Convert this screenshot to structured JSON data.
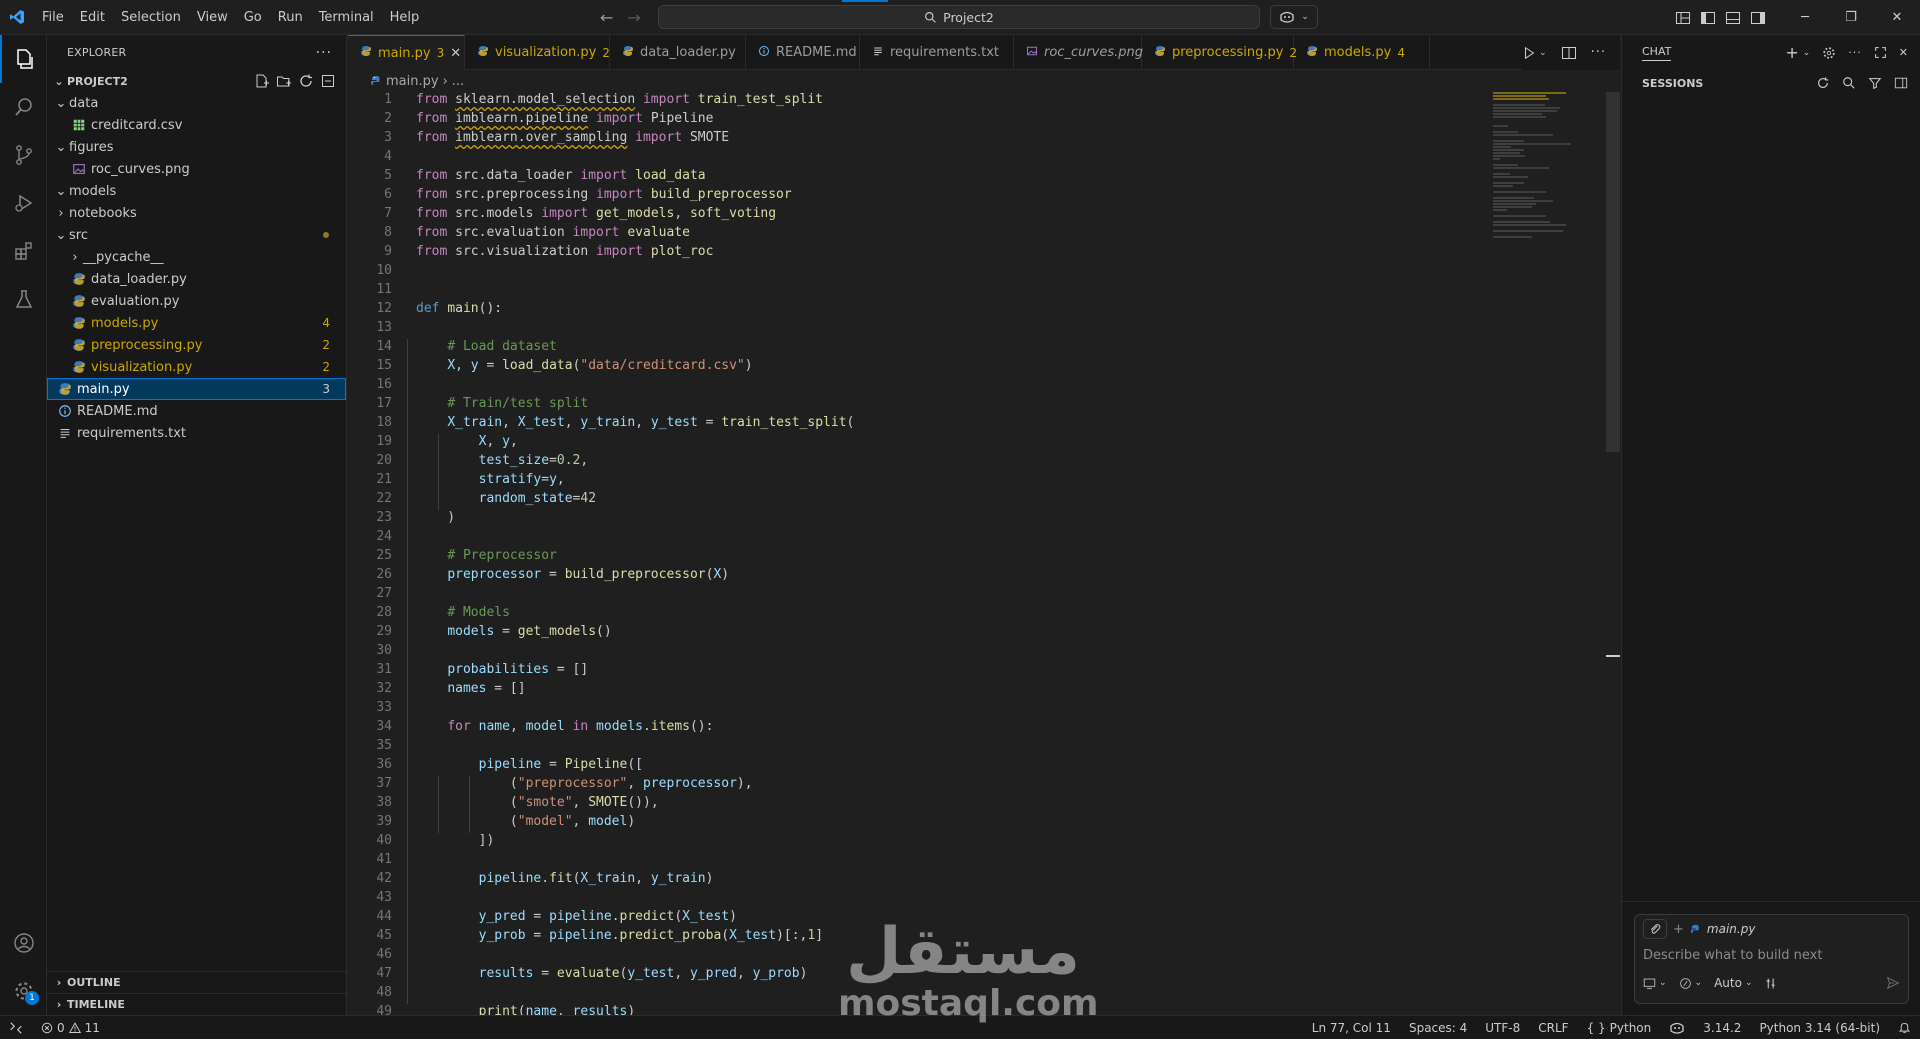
{
  "titlebar": {
    "menu": [
      "File",
      "Edit",
      "Selection",
      "View",
      "Go",
      "Run",
      "Terminal",
      "Help"
    ],
    "search_text": "Project2"
  },
  "sidebar": {
    "title": "EXPLORER",
    "project": "PROJECT2",
    "tree": [
      {
        "label": "data",
        "type": "folder",
        "open": true,
        "depth": 0
      },
      {
        "label": "creditcard.csv",
        "type": "csv",
        "depth": 1
      },
      {
        "label": "figures",
        "type": "folder",
        "open": true,
        "depth": 0
      },
      {
        "label": "roc_curves.png",
        "type": "image",
        "depth": 1
      },
      {
        "label": "models",
        "type": "folder",
        "open": true,
        "depth": 0
      },
      {
        "label": "notebooks",
        "type": "folder",
        "open": false,
        "depth": 0
      },
      {
        "label": "src",
        "type": "folder",
        "open": true,
        "depth": 0,
        "warn": true
      },
      {
        "label": "__pycache__",
        "type": "folder",
        "open": false,
        "depth": 1
      },
      {
        "label": "data_loader.py",
        "type": "py",
        "depth": 1
      },
      {
        "label": "evaluation.py",
        "type": "py",
        "depth": 1
      },
      {
        "label": "models.py",
        "type": "py",
        "depth": 1,
        "warn": true,
        "count": "4"
      },
      {
        "label": "preprocessing.py",
        "type": "py",
        "depth": 1,
        "warn": true,
        "count": "2"
      },
      {
        "label": "visualization.py",
        "type": "py",
        "depth": 1,
        "warn": true,
        "count": "2"
      },
      {
        "label": "main.py",
        "type": "py",
        "depth": 0,
        "warn": true,
        "count": "3",
        "selected": true
      },
      {
        "label": "README.md",
        "type": "info",
        "depth": 0
      },
      {
        "label": "requirements.txt",
        "type": "txt",
        "depth": 0
      }
    ],
    "outline": "OUTLINE",
    "timeline": "TIMELINE"
  },
  "tabs": [
    {
      "label": "main.py",
      "count": "3",
      "active": true,
      "icon": "python-icon",
      "warn": true
    },
    {
      "label": "visualization.py",
      "count": "2",
      "icon": "python-icon",
      "warn": true
    },
    {
      "label": "data_loader.py",
      "count": "",
      "icon": "python-icon"
    },
    {
      "label": "README.md",
      "count": "",
      "icon": "info-icon"
    },
    {
      "label": "requirements.txt",
      "count": "",
      "icon": "lines-icon"
    },
    {
      "label": "roc_curves.png",
      "count": "",
      "icon": "image-icon",
      "italic": true
    },
    {
      "label": "preprocessing.py",
      "count": "2",
      "icon": "python-icon",
      "warn": true
    },
    {
      "label": "models.py",
      "count": "4",
      "icon": "python-icon",
      "warn": true
    }
  ],
  "breadcrumb": {
    "file": "main.py",
    "rest": "..."
  },
  "code_lines": [
    [
      [
        "kw-imp",
        "from "
      ],
      [
        "mod ul",
        "sklearn.model_selection"
      ],
      [
        "kw-imp",
        " import "
      ],
      [
        "fn",
        "train_test_split"
      ]
    ],
    [
      [
        "kw-imp",
        "from "
      ],
      [
        "mod ul",
        "imblearn.pipeline"
      ],
      [
        "kw-imp",
        " import "
      ],
      [
        "mod",
        "Pipeline"
      ]
    ],
    [
      [
        "kw-imp",
        "from "
      ],
      [
        "mod ul",
        "imblearn.over_sampling"
      ],
      [
        "kw-imp",
        " import "
      ],
      [
        "mod",
        "SMOTE"
      ]
    ],
    [],
    [
      [
        "kw-imp",
        "from "
      ],
      [
        "mod",
        "src.data_loader"
      ],
      [
        "kw-imp",
        " import "
      ],
      [
        "fn",
        "load_data"
      ]
    ],
    [
      [
        "kw-imp",
        "from "
      ],
      [
        "mod",
        "src.preprocessing"
      ],
      [
        "kw-imp",
        " import "
      ],
      [
        "fn",
        "build_preprocessor"
      ]
    ],
    [
      [
        "kw-imp",
        "from "
      ],
      [
        "mod",
        "src.models"
      ],
      [
        "kw-imp",
        " import "
      ],
      [
        "fn",
        "get_models"
      ],
      [
        "mod",
        ", "
      ],
      [
        "fn",
        "soft_voting"
      ]
    ],
    [
      [
        "kw-imp",
        "from "
      ],
      [
        "mod",
        "src.evaluation"
      ],
      [
        "kw-imp",
        " import "
      ],
      [
        "fn",
        "evaluate"
      ]
    ],
    [
      [
        "kw-imp",
        "from "
      ],
      [
        "mod",
        "src.visualization"
      ],
      [
        "kw-imp",
        " import "
      ],
      [
        "fn",
        "plot_roc"
      ]
    ],
    [],
    [],
    [
      [
        "kw-def",
        "def "
      ],
      [
        "fn",
        "main"
      ],
      [
        "mod",
        "():"
      ]
    ],
    [],
    [
      [
        "mod",
        "    "
      ],
      [
        "cm",
        "# Load dataset"
      ]
    ],
    [
      [
        "mod",
        "    "
      ],
      [
        "var",
        "X"
      ],
      [
        "mod",
        ", "
      ],
      [
        "var",
        "y"
      ],
      [
        "mod",
        " = "
      ],
      [
        "fn",
        "load_data"
      ],
      [
        "mod",
        "("
      ],
      [
        "str",
        "\"data/creditcard.csv\""
      ],
      [
        "mod",
        ")"
      ]
    ],
    [],
    [
      [
        "mod",
        "    "
      ],
      [
        "cm",
        "# Train/test split"
      ]
    ],
    [
      [
        "mod",
        "    "
      ],
      [
        "var",
        "X_train"
      ],
      [
        "mod",
        ", "
      ],
      [
        "var",
        "X_test"
      ],
      [
        "mod",
        ", "
      ],
      [
        "var",
        "y_train"
      ],
      [
        "mod",
        ", "
      ],
      [
        "var",
        "y_test"
      ],
      [
        "mod",
        " = "
      ],
      [
        "fn",
        "train_test_split"
      ],
      [
        "mod",
        "("
      ]
    ],
    [
      [
        "mod",
        "        "
      ],
      [
        "var",
        "X"
      ],
      [
        "mod",
        ", "
      ],
      [
        "var",
        "y"
      ],
      [
        "mod",
        ","
      ]
    ],
    [
      [
        "mod",
        "        "
      ],
      [
        "var",
        "test_size"
      ],
      [
        "mod",
        "="
      ],
      [
        "num",
        "0.2"
      ],
      [
        "mod",
        ","
      ]
    ],
    [
      [
        "mod",
        "        "
      ],
      [
        "var",
        "stratify"
      ],
      [
        "mod",
        "="
      ],
      [
        "var",
        "y"
      ],
      [
        "mod",
        ","
      ]
    ],
    [
      [
        "mod",
        "        "
      ],
      [
        "var",
        "random_state"
      ],
      [
        "mod",
        "="
      ],
      [
        "num",
        "42"
      ]
    ],
    [
      [
        "mod",
        "    )"
      ]
    ],
    [],
    [
      [
        "mod",
        "    "
      ],
      [
        "cm",
        "# Preprocessor"
      ]
    ],
    [
      [
        "mod",
        "    "
      ],
      [
        "var",
        "preprocessor"
      ],
      [
        "mod",
        " = "
      ],
      [
        "fn",
        "build_preprocessor"
      ],
      [
        "mod",
        "("
      ],
      [
        "var",
        "X"
      ],
      [
        "mod",
        ")"
      ]
    ],
    [],
    [
      [
        "mod",
        "    "
      ],
      [
        "cm",
        "# Models"
      ]
    ],
    [
      [
        "mod",
        "    "
      ],
      [
        "var",
        "models"
      ],
      [
        "mod",
        " = "
      ],
      [
        "fn",
        "get_models"
      ],
      [
        "mod",
        "()"
      ]
    ],
    [],
    [
      [
        "mod",
        "    "
      ],
      [
        "var",
        "probabilities"
      ],
      [
        "mod",
        " = []"
      ]
    ],
    [
      [
        "mod",
        "    "
      ],
      [
        "var",
        "names"
      ],
      [
        "mod",
        " = []"
      ]
    ],
    [],
    [
      [
        "mod",
        "    "
      ],
      [
        "kw-imp",
        "for "
      ],
      [
        "var",
        "name"
      ],
      [
        "mod",
        ", "
      ],
      [
        "var",
        "model"
      ],
      [
        "kw-imp",
        " in "
      ],
      [
        "var",
        "models"
      ],
      [
        "mod",
        "."
      ],
      [
        "fn",
        "items"
      ],
      [
        "mod",
        "():"
      ]
    ],
    [],
    [
      [
        "mod",
        "        "
      ],
      [
        "var",
        "pipeline"
      ],
      [
        "mod",
        " = "
      ],
      [
        "fn",
        "Pipeline"
      ],
      [
        "mod",
        "(["
      ]
    ],
    [
      [
        "mod",
        "            ("
      ],
      [
        "str",
        "\"preprocessor\""
      ],
      [
        "mod",
        ", "
      ],
      [
        "var",
        "preprocessor"
      ],
      [
        "mod",
        "),"
      ]
    ],
    [
      [
        "mod",
        "            ("
      ],
      [
        "str",
        "\"smote\""
      ],
      [
        "mod",
        ", "
      ],
      [
        "fn",
        "SMOTE"
      ],
      [
        "mod",
        "()),"
      ]
    ],
    [
      [
        "mod",
        "            ("
      ],
      [
        "str",
        "\"model\""
      ],
      [
        "mod",
        ", "
      ],
      [
        "var",
        "model"
      ],
      [
        "mod",
        ")"
      ]
    ],
    [
      [
        "mod",
        "        ])"
      ]
    ],
    [],
    [
      [
        "mod",
        "        "
      ],
      [
        "var",
        "pipeline"
      ],
      [
        "mod",
        "."
      ],
      [
        "fn",
        "fit"
      ],
      [
        "mod",
        "("
      ],
      [
        "var",
        "X_train"
      ],
      [
        "mod",
        ", "
      ],
      [
        "var",
        "y_train"
      ],
      [
        "mod",
        ")"
      ]
    ],
    [],
    [
      [
        "mod",
        "        "
      ],
      [
        "var",
        "y_pred"
      ],
      [
        "mod",
        " = "
      ],
      [
        "var",
        "pipeline"
      ],
      [
        "mod",
        "."
      ],
      [
        "fn",
        "predict"
      ],
      [
        "mod",
        "("
      ],
      [
        "var",
        "X_test"
      ],
      [
        "mod",
        ")"
      ]
    ],
    [
      [
        "mod",
        "        "
      ],
      [
        "var",
        "y_prob"
      ],
      [
        "mod",
        " = "
      ],
      [
        "var",
        "pipeline"
      ],
      [
        "mod",
        "."
      ],
      [
        "fn",
        "predict_proba"
      ],
      [
        "mod",
        "("
      ],
      [
        "var",
        "X_test"
      ],
      [
        "mod",
        ")[:,"
      ],
      [
        "num",
        "1"
      ],
      [
        "mod",
        "]"
      ]
    ],
    [],
    [
      [
        "mod",
        "        "
      ],
      [
        "var",
        "results"
      ],
      [
        "mod",
        " = "
      ],
      [
        "fn",
        "evaluate"
      ],
      [
        "mod",
        "("
      ],
      [
        "var",
        "y_test"
      ],
      [
        "mod",
        ", "
      ],
      [
        "var",
        "y_pred"
      ],
      [
        "mod",
        ", "
      ],
      [
        "var",
        "y_prob"
      ],
      [
        "mod",
        ")"
      ]
    ],
    [],
    [
      [
        "mod",
        "        "
      ],
      [
        "fn",
        "print"
      ],
      [
        "mod",
        "("
      ],
      [
        "var",
        "name"
      ],
      [
        "mod",
        ", "
      ],
      [
        "var",
        "results"
      ],
      [
        "mod",
        ")"
      ]
    ]
  ],
  "chat": {
    "title": "CHAT",
    "sessions": "SESSIONS",
    "context_file": "main.py",
    "placeholder": "Describe what to build next",
    "mode": "Auto"
  },
  "statusbar": {
    "errors": "0",
    "warnings": "11",
    "position": "Ln 77, Col 11",
    "spaces": "Spaces: 4",
    "encoding": "UTF-8",
    "eol": "CRLF",
    "language": "Python",
    "version": "3.14.2",
    "interpreter": "Python 3.14 (64-bit)"
  },
  "activity_badge": "1",
  "watermark": {
    "arabic": "مستقل",
    "latin": "mostaql.com"
  },
  "colors": {
    "accent": "#0078d4",
    "warning": "#cca700",
    "background": "#1f1f1f"
  }
}
